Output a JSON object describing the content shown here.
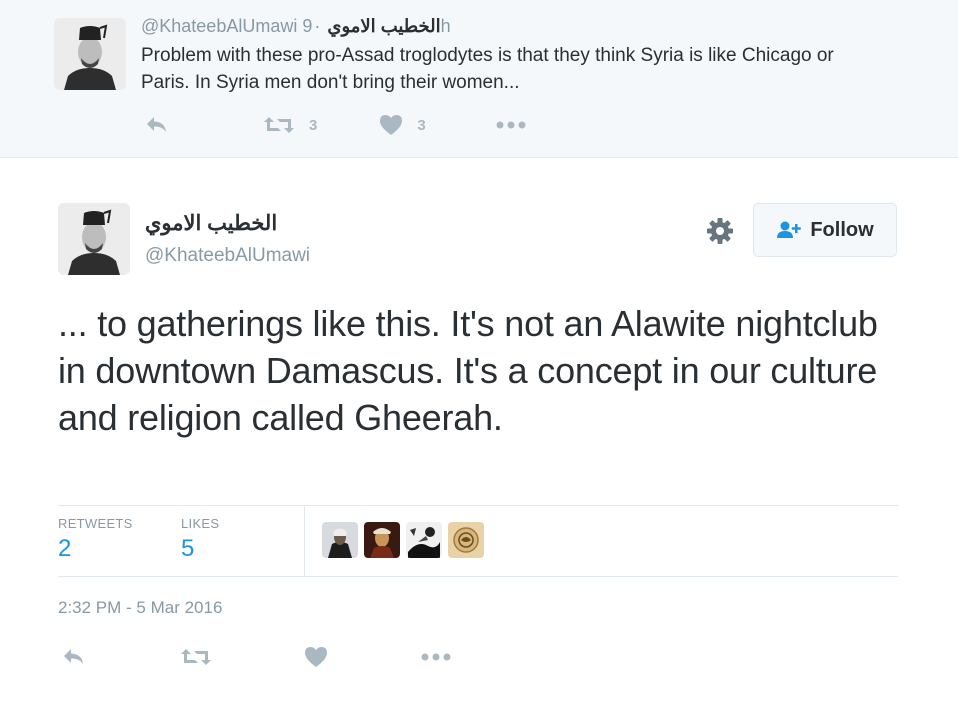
{
  "parent_tweet": {
    "handle": "@KhateebAlUmawi",
    "name": "الخطيب الاموي",
    "separator": "·",
    "time": "9h",
    "text": "Problem with these pro-Assad troglodytes is that they think Syria is like Chicago or Paris. In Syria men don't bring their women...",
    "actions": {
      "reply_icon": "reply-icon",
      "retweet_count": "3",
      "like_count": "3",
      "more_icon": "more-icon"
    }
  },
  "tweet": {
    "name": "الخطيب الاموي",
    "handle": "@KhateebAlUmawi",
    "follow_label": "Follow",
    "text": "... to gatherings like this. It's not an Alawite nightclub in downtown Damascus. It's a concept in our culture and religion called Gheerah.",
    "stats": {
      "retweets_label": "RETWEETS",
      "retweets_value": "2",
      "likes_label": "LIKES",
      "likes_value": "5"
    },
    "likers": [
      "liker-1",
      "liker-2",
      "liker-3",
      "liker-4"
    ],
    "timestamp": "2:32 PM - 5 Mar 2016"
  },
  "colors": {
    "accent": "#1b95e0",
    "muted": "#8899a6",
    "icon": "#aab8c2",
    "text": "#292f33",
    "border": "#e1e8ed",
    "parent_bg": "#f5f8fa"
  }
}
